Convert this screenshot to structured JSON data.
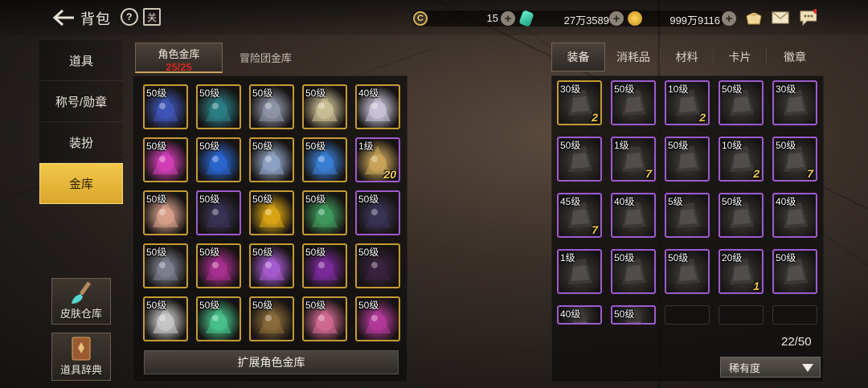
{
  "header": {
    "title": "背包",
    "help_glyph": "?",
    "book_glyph": "关"
  },
  "currency": {
    "c_glyph": "C",
    "c_value": "15",
    "gem_value": "27万3589",
    "gold_value": "999万9116",
    "plus": "+"
  },
  "nav": {
    "items": [
      {
        "label": "道具"
      },
      {
        "label": "称号/勋章"
      },
      {
        "label": "装扮"
      },
      {
        "label": "金库"
      }
    ],
    "active": 3
  },
  "side": {
    "skin_label": "皮肤仓库",
    "dict_label": "道具辞典"
  },
  "vault": {
    "tab_role_title": "角色金库",
    "tab_role_count": "25/25",
    "tab_guild": "冒险团金库",
    "expand_label": "扩展角色金库"
  },
  "left_items": [
    {
      "lvl": "50级",
      "c": "#3f56b8",
      "b": "gold"
    },
    {
      "lvl": "50级",
      "c": "#2c7f86",
      "b": "gold"
    },
    {
      "lvl": "50级",
      "c": "#8e95a8",
      "b": "gold"
    },
    {
      "lvl": "50级",
      "c": "#cbbf95",
      "b": "gold"
    },
    {
      "lvl": "40级",
      "c": "#c9c2d8",
      "b": "gold"
    },
    {
      "lvl": "50级",
      "c": "#d33fb8",
      "b": "gold"
    },
    {
      "lvl": "50级",
      "c": "#2a66d0",
      "b": "gold"
    },
    {
      "lvl": "50级",
      "c": "#8fa3c4",
      "b": "gold"
    },
    {
      "lvl": "50级",
      "c": "#3a7fd6",
      "b": "gold"
    },
    {
      "lvl": "1级",
      "c": "#c9a55a",
      "b": "purple",
      "cnt": "20"
    },
    {
      "lvl": "50级",
      "c": "#d9a08c",
      "b": "gold"
    },
    {
      "lvl": "50级",
      "c": "#3a3355",
      "b": "purple"
    },
    {
      "lvl": "50级",
      "c": "#d9a514",
      "b": "gold"
    },
    {
      "lvl": "50级",
      "c": "#3f9a5c",
      "b": "gold"
    },
    {
      "lvl": "50级",
      "c": "#3a3355",
      "b": "purple"
    },
    {
      "lvl": "50级",
      "c": "#7d8090",
      "b": "gold"
    },
    {
      "lvl": "50级",
      "c": "#a8308f",
      "b": "gold"
    },
    {
      "lvl": "50级",
      "c": "#a55bd0",
      "b": "gold"
    },
    {
      "lvl": "50级",
      "c": "#7a2a9a",
      "b": "gold"
    },
    {
      "lvl": "50级",
      "c": "#3a2340",
      "b": "gold"
    },
    {
      "lvl": "50级",
      "c": "#c7c7c7",
      "b": "gold"
    },
    {
      "lvl": "50级",
      "c": "#47c28c",
      "b": "gold"
    },
    {
      "lvl": "50级",
      "c": "#8a6a3a",
      "b": "gold"
    },
    {
      "lvl": "50级",
      "c": "#d26a92",
      "b": "gold"
    },
    {
      "lvl": "50级",
      "c": "#b33a9a",
      "b": "gold"
    }
  ],
  "right_tabs": [
    {
      "label": "装备"
    },
    {
      "label": "消耗品"
    },
    {
      "label": "材料"
    },
    {
      "label": "卡片"
    },
    {
      "label": "徽章"
    }
  ],
  "right_items": [
    {
      "lvl": "30级",
      "b": "gold",
      "cnt": "2"
    },
    {
      "lvl": "50级",
      "b": "purple"
    },
    {
      "lvl": "10级",
      "b": "purple",
      "cnt": "2"
    },
    {
      "lvl": "50级",
      "b": "purple"
    },
    {
      "lvl": "30级",
      "b": "purple"
    },
    {
      "lvl": "50级",
      "b": "purple"
    },
    {
      "lvl": "1级",
      "b": "purple",
      "cnt": "7"
    },
    {
      "lvl": "50级",
      "b": "purple"
    },
    {
      "lvl": "10级",
      "b": "purple",
      "cnt": "2"
    },
    {
      "lvl": "50级",
      "b": "purple",
      "cnt": "7"
    },
    {
      "lvl": "45级",
      "b": "purple",
      "cnt": "7"
    },
    {
      "lvl": "40级",
      "b": "purple"
    },
    {
      "lvl": "5级",
      "b": "purple"
    },
    {
      "lvl": "50级",
      "b": "purple"
    },
    {
      "lvl": "40级",
      "b": "purple"
    },
    {
      "lvl": "1级",
      "b": "purple"
    },
    {
      "lvl": "50级",
      "b": "purple"
    },
    {
      "lvl": "50级",
      "b": "purple"
    },
    {
      "lvl": "20级",
      "b": "purple",
      "cnt": "1"
    },
    {
      "lvl": "50级",
      "b": "purple"
    },
    {
      "lvl": "40级",
      "b": "purple"
    },
    {
      "lvl": "50级",
      "b": "purple"
    },
    {
      "lvl": "",
      "b": "empty"
    },
    {
      "lvl": "",
      "b": "empty"
    },
    {
      "lvl": "",
      "b": "empty"
    }
  ],
  "inventory": {
    "count": "22/50",
    "sort_label": "稀有度"
  },
  "colors": {
    "accent": "#f2c84a",
    "gold_border": "#c79a35",
    "purple_border": "#a05ad0",
    "red_count": "#d22a1f"
  }
}
